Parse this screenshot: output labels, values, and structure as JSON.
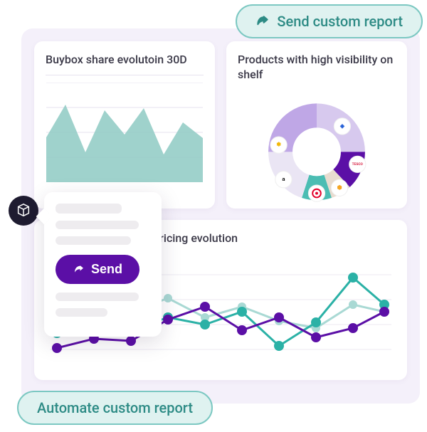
{
  "pills": {
    "top_label": "Send custom report",
    "bottom_label": "Automate custom report"
  },
  "popover": {
    "send_label": "Send"
  },
  "cards": {
    "area": {
      "title": "Buybox share evolutoin 30D"
    },
    "donut": {
      "title": "Products with high visibility on shelf"
    },
    "line": {
      "title": "Pricing evolution"
    }
  },
  "colors": {
    "teal": "#7fc4bd",
    "teal_dark": "#2bb1a6",
    "purple": "#5b0fa6",
    "lavender_light": "#d7c9ee",
    "lavender_mid": "#bfa7e6",
    "mint_bg": "#dff2f0"
  },
  "chart_data": [
    {
      "type": "area",
      "id": "buybox_share_30d",
      "title": "Buybox share evolutoin 30D",
      "xlabel": "",
      "ylabel": "",
      "x": [
        0,
        1,
        2,
        3,
        4,
        5,
        6,
        7,
        8
      ],
      "values": [
        45,
        78,
        30,
        72,
        48,
        74,
        28,
        60,
        44
      ],
      "ylim": [
        0,
        100
      ]
    },
    {
      "type": "pie",
      "id": "products_high_visibility",
      "title": "Products with high visibility on shelf",
      "series": [
        {
          "name": "Carrefour",
          "value": 25,
          "color": "#d7c9ee"
        },
        {
          "name": "Tesco",
          "value": 12,
          "color": "#5b0fa6"
        },
        {
          "name": "OtherA",
          "value": 8,
          "color": "#e8dcd0"
        },
        {
          "name": "Target",
          "value": 10,
          "color": "#4bbdb3"
        },
        {
          "name": "Amazon",
          "value": 20,
          "color": "#eae5f4"
        },
        {
          "name": "Walmart",
          "value": 25,
          "color": "#bfa7e6"
        }
      ]
    },
    {
      "type": "line",
      "id": "pricing_evolution",
      "title": "Pricing evolution",
      "x": [
        0,
        1,
        2,
        3,
        4,
        5,
        6,
        7,
        8,
        9
      ],
      "ylim": [
        0,
        100
      ],
      "series": [
        {
          "name": "series_teal_light",
          "color": "#a9d9d4",
          "values": [
            60,
            72,
            55,
            68,
            50,
            60,
            47,
            40,
            62,
            55
          ]
        },
        {
          "name": "series_teal",
          "color": "#2bb1a6",
          "values": [
            35,
            70,
            38,
            50,
            42,
            55,
            25,
            45,
            80,
            58
          ]
        },
        {
          "name": "series_purple",
          "color": "#5b0fa6",
          "values": [
            22,
            30,
            28,
            48,
            60,
            38,
            50,
            33,
            40,
            55
          ]
        }
      ]
    }
  ]
}
